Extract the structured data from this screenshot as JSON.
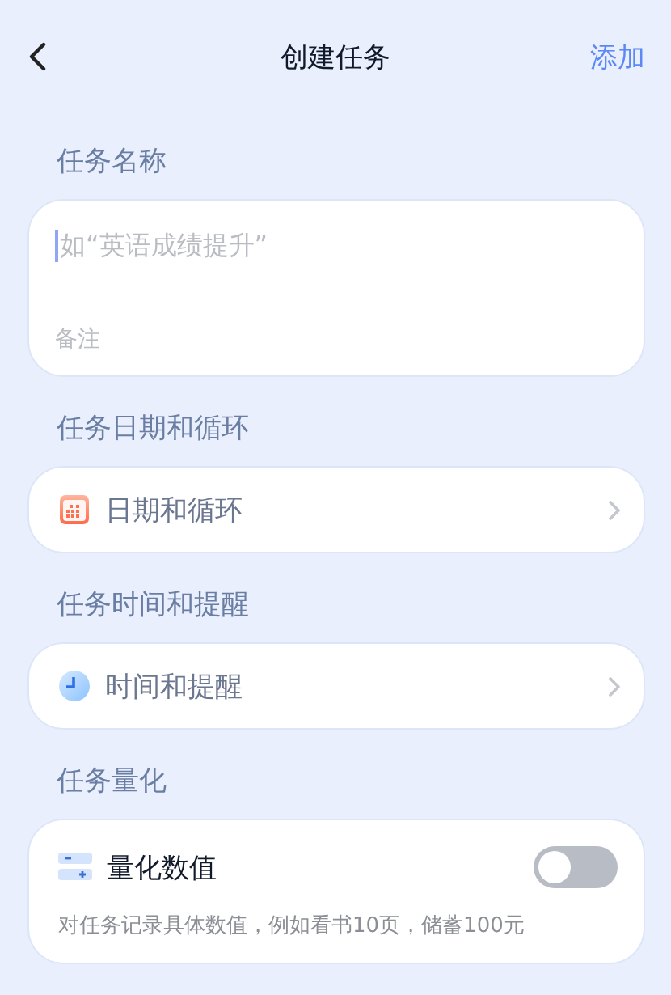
{
  "header": {
    "title": "创建任务",
    "action": "添加"
  },
  "sections": [
    {
      "kind": "fields",
      "label": "任务名称",
      "name_field": {
        "placeholder": "如“英语成绩提升”",
        "focused": true
      },
      "note_field": {
        "placeholder": "备注"
      }
    },
    {
      "kind": "date",
      "label": "任务日期和循环",
      "row": "日期和循环"
    },
    {
      "kind": "time",
      "label": "任务时间和提醒",
      "row": "时间和提醒"
    },
    {
      "kind": "quantity",
      "label": "任务量化",
      "row": "量化数值",
      "on": false,
      "description": "对任务记录具体数值，例如看书10页，储蓄100元"
    }
  ]
}
